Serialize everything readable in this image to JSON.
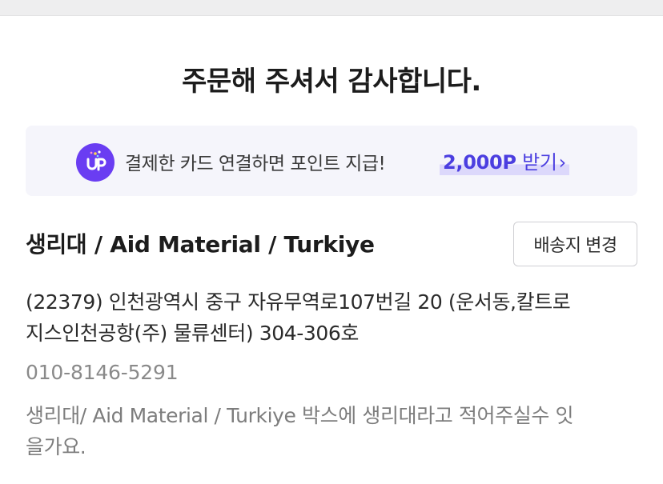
{
  "page": {
    "title": "주문해 주셔서 감사합니다."
  },
  "banner": {
    "icon": "up-point-icon",
    "text": "결제한 카드 연결하면 포인트 지급!",
    "points": "2,000P",
    "action": "받기",
    "chevron": "›",
    "colors": {
      "accent": "#4b3ee0",
      "icon_bg": "#6a3df2",
      "highlight": "#dcd8fb",
      "background": "#f5f5fb"
    }
  },
  "shipping": {
    "recipient": "생리대 / Aid Material / Turkiye",
    "change_button": "배송지 변경",
    "address_line1": "(22379) 인천광역시 중구 자유무역로107번길 20 (운서동,칼트로",
    "address_line2": "지스인천공항(주) 물류센터) 304-306호",
    "phone": "010-8146-5291",
    "memo_line1": "생리대/ Aid Material / Turkiye 박스에 생리대라고 적어주실수 잇",
    "memo_line2": "을가요."
  }
}
